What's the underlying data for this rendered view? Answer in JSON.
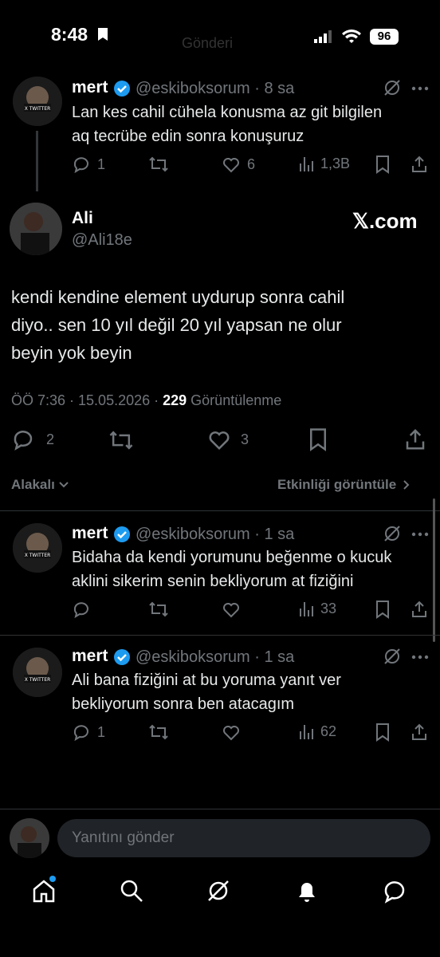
{
  "status_bar": {
    "time": "8:48",
    "battery": "96",
    "faint_title": "Gönderi"
  },
  "parent_reply": {
    "name": "mert",
    "handle": "@eskiboksorum",
    "time": "8 sa",
    "text_lines": [
      "Lan kes cahil cühela konusma az git bilgilen",
      "aq tecrübe edin sonra konuşuruz"
    ],
    "replies": "1",
    "likes": "6",
    "views": "1,3B"
  },
  "main_tweet": {
    "name": "Ali",
    "handle": "@Ali18e",
    "watermark": "𝕏.com",
    "text_lines": [
      "kendi kendine element uydurup sonra cahil",
      "diyo.. sen 10 yıl değil 20 yıl yapsan ne olur",
      "beyin yok beyin"
    ],
    "timestamp": "ÖÖ 7:36 · 15.05.2026 · ",
    "views_count": "229",
    "views_label": " Görüntülenme",
    "replies": "2",
    "likes": "3"
  },
  "sort_bar": {
    "left": "Alakalı",
    "right": "Etkinliği görüntüle"
  },
  "replies": [
    {
      "name": "mert",
      "handle": "@eskiboksorum",
      "time": "1 sa",
      "text_lines": [
        "Bidaha da kendi yorumunu beğenme o kucuk",
        "aklini sikerim senin bekliyorum at fiziğini"
      ],
      "replies": "",
      "views": "33"
    },
    {
      "name": "mert",
      "handle": "@eskiboksorum",
      "time": "1 sa",
      "text_lines": [
        "Ali bana fiziğini at bu yoruma yanıt ver",
        "bekliyorum sonra ben atacagım"
      ],
      "replies": "1",
      "views": "62"
    }
  ],
  "compose": {
    "placeholder": "Yanıtını gönder"
  },
  "nav": [
    "home-icon",
    "search-icon",
    "grok-icon",
    "notifications-icon",
    "messages-icon"
  ],
  "colors": {
    "accent": "#1d9bf0",
    "muted": "#71767b",
    "bg": "#000000"
  }
}
